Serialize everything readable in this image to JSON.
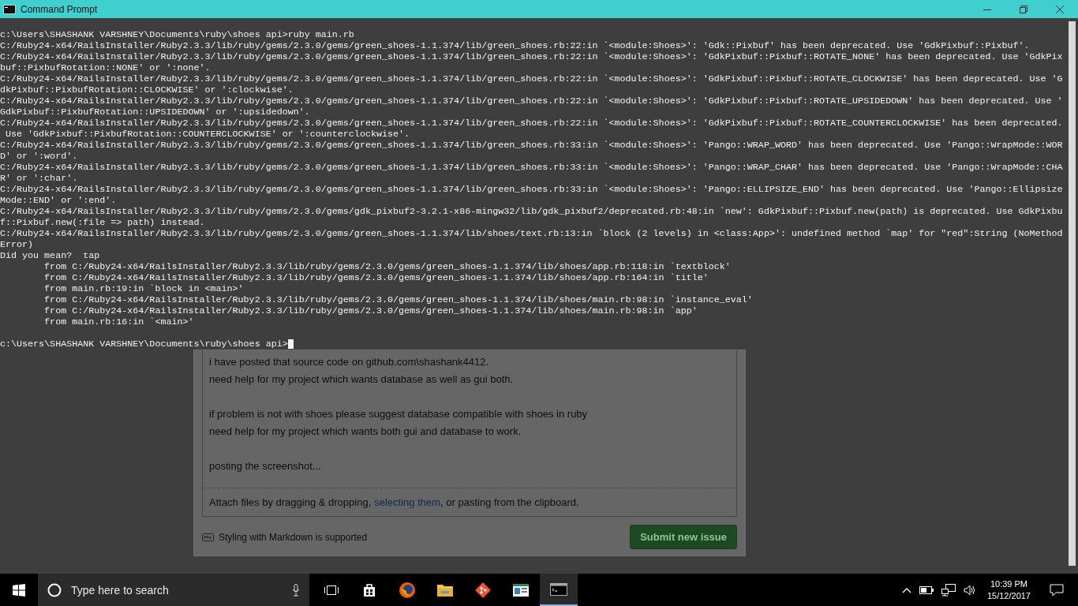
{
  "window": {
    "title": "Command Prompt"
  },
  "console": {
    "lines": [
      "c:\\Users\\SHASHANK VARSHNEY\\Documents\\ruby\\shoes api>ruby main.rb",
      "C:/Ruby24-x64/RailsInstaller/Ruby2.3.3/lib/ruby/gems/2.3.0/gems/green_shoes-1.1.374/lib/green_shoes.rb:22:in `<module:Shoes>': 'Gdk::Pixbuf' has been deprecated. Use 'GdkPixbuf::Pixbuf'.",
      "C:/Ruby24-x64/RailsInstaller/Ruby2.3.3/lib/ruby/gems/2.3.0/gems/green_shoes-1.1.374/lib/green_shoes.rb:22:in `<module:Shoes>': 'GdkPixbuf::Pixbuf::ROTATE_NONE' has been deprecated. Use 'GdkPix",
      "buf::PixbufRotation::NONE' or ':none'.",
      "C:/Ruby24-x64/RailsInstaller/Ruby2.3.3/lib/ruby/gems/2.3.0/gems/green_shoes-1.1.374/lib/green_shoes.rb:22:in `<module:Shoes>': 'GdkPixbuf::Pixbuf::ROTATE_CLOCKWISE' has been deprecated. Use 'G",
      "dkPixbuf::PixbufRotation::CLOCKWISE' or ':clockwise'.",
      "C:/Ruby24-x64/RailsInstaller/Ruby2.3.3/lib/ruby/gems/2.3.0/gems/green_shoes-1.1.374/lib/green_shoes.rb:22:in `<module:Shoes>': 'GdkPixbuf::Pixbuf::ROTATE_UPSIDEDOWN' has been deprecated. Use '",
      "GdkPixbuf::PixbufRotation::UPSIDEDOWN' or ':upsidedown'.",
      "C:/Ruby24-x64/RailsInstaller/Ruby2.3.3/lib/ruby/gems/2.3.0/gems/green_shoes-1.1.374/lib/green_shoes.rb:22:in `<module:Shoes>': 'GdkPixbuf::Pixbuf::ROTATE_COUNTERCLOCKWISE' has been deprecated.",
      " Use 'GdkPixbuf::PixbufRotation::COUNTERCLOCKWISE' or ':counterclockwise'.",
      "C:/Ruby24-x64/RailsInstaller/Ruby2.3.3/lib/ruby/gems/2.3.0/gems/green_shoes-1.1.374/lib/green_shoes.rb:33:in `<module:Shoes>': 'Pango::WRAP_WORD' has been deprecated. Use 'Pango::WrapMode::WOR",
      "D' or ':word'.",
      "C:/Ruby24-x64/RailsInstaller/Ruby2.3.3/lib/ruby/gems/2.3.0/gems/green_shoes-1.1.374/lib/green_shoes.rb:33:in `<module:Shoes>': 'Pango::WRAP_CHAR' has been deprecated. Use 'Pango::WrapMode::CHA",
      "R' or ':char'.",
      "C:/Ruby24-x64/RailsInstaller/Ruby2.3.3/lib/ruby/gems/2.3.0/gems/green_shoes-1.1.374/lib/green_shoes.rb:33:in `<module:Shoes>': 'Pango::ELLIPSIZE_END' has been deprecated. Use 'Pango::Ellipsize",
      "Mode::END' or ':end'.",
      "C:/Ruby24-x64/RailsInstaller/Ruby2.3.3/lib/ruby/gems/2.3.0/gems/gdk_pixbuf2-3.2.1-x86-mingw32/lib/gdk_pixbuf2/deprecated.rb:48:in `new': GdkPixbuf::Pixbuf.new(path) is deprecated. Use GdkPixbu",
      "f::Pixbuf.new(:file => path) instead.",
      "C:/Ruby24-x64/RailsInstaller/Ruby2.3.3/lib/ruby/gems/2.3.0/gems/green_shoes-1.1.374/lib/shoes/text.rb:13:in `block (2 levels) in <class:App>': undefined method `map' for \"red\":String (NoMethod",
      "Error)",
      "Did you mean?  tap",
      "        from C:/Ruby24-x64/RailsInstaller/Ruby2.3.3/lib/ruby/gems/2.3.0/gems/green_shoes-1.1.374/lib/shoes/app.rb:118:in `textblock'",
      "        from C:/Ruby24-x64/RailsInstaller/Ruby2.3.3/lib/ruby/gems/2.3.0/gems/green_shoes-1.1.374/lib/shoes/app.rb:164:in `title'",
      "        from main.rb:19:in `block in <main>'",
      "        from C:/Ruby24-x64/RailsInstaller/Ruby2.3.3/lib/ruby/gems/2.3.0/gems/green_shoes-1.1.374/lib/shoes/main.rb:98:in `instance_eval'",
      "        from C:/Ruby24-x64/RailsInstaller/Ruby2.3.3/lib/ruby/gems/2.3.0/gems/green_shoes-1.1.374/lib/shoes/main.rb:98:in `app'",
      "        from main.rb:16:in `<main>'"
    ],
    "prompt": "c:\\Users\\SHASHANK VARSHNEY\\Documents\\ruby\\shoes api>"
  },
  "background_page": {
    "body_lines": [
      "i have posted that source code on github.com\\shashank4412.",
      "need help for my project which wants database as well as gui both.",
      "if problem is not with shoes please suggest database compatible with shoes in ruby",
      "need help for my project which wants both gui and database to work.",
      "posting the screenshot..."
    ],
    "attach_before": "Attach files by dragging & dropping,",
    "attach_link": "selecting them",
    "attach_after": ", or pasting from the clipboard.",
    "markdown_note": "Styling with Markdown is supported",
    "submit_button": "Submit new issue"
  },
  "taskbar": {
    "search_placeholder": "Type here to search",
    "apps": [
      {
        "kind": "store",
        "selected": false
      },
      {
        "kind": "firefox",
        "selected": false
      },
      {
        "kind": "folder",
        "selected": false
      },
      {
        "kind": "git",
        "selected": false
      },
      {
        "kind": "viewer",
        "selected": false
      },
      {
        "kind": "console",
        "selected": true
      }
    ],
    "time": "10:39 PM",
    "date": "15/12/2017"
  }
}
